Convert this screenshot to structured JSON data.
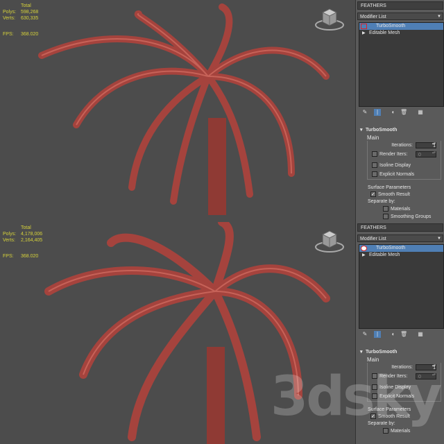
{
  "colors": {
    "feather": "#b5423b",
    "feather_light": "#cf6a5f",
    "viewport_bg": "#4c4c4c",
    "stats": "#d6d23a",
    "selected": "#4f7fb5",
    "highlight_box": "#dd2222"
  },
  "panes": [
    {
      "stats": {
        "total_label": "Total",
        "polys_label": "Polys:",
        "polys": "598,268",
        "verts_label": "Verts:",
        "verts": "630,335",
        "fps_label": "FPS:",
        "fps": "368.020"
      },
      "panel": {
        "object_name": "FEATHERS",
        "modifier_list": "Modifier List",
        "stack": [
          "TurboSmooth",
          "Editable Mesh"
        ],
        "turbosmooth": {
          "title": "TurboSmooth",
          "main_label": "Main",
          "iterations_label": "Iterations:",
          "iterations": "1",
          "render_iters_label": "Render Iters:",
          "render_iters": "0",
          "isoline_label": "Isoline Display",
          "explicit_label": "Explicit Normals",
          "surface_label": "Surface Parameters",
          "smooth_label": "Smooth Result",
          "separate_label": "Separate by:",
          "materials_label": "Materials",
          "smoothing_label": "Smoothing Groups"
        }
      }
    },
    {
      "stats": {
        "total_label": "Total",
        "polys_label": "Polys:",
        "polys": "4,178,006",
        "verts_label": "Verts:",
        "verts": "2,164,405",
        "fps_label": "FPS:",
        "fps": "368.020"
      },
      "panel": {
        "object_name": "FEATHERS",
        "modifier_list": "Modifier List",
        "stack": [
          "TurboSmooth",
          "Editable Mesh"
        ],
        "turbosmooth": {
          "title": "TurboSmooth",
          "main_label": "Main",
          "iterations_label": "Iterations:",
          "iterations": "1",
          "render_iters_label": "Render Iters:",
          "render_iters": "0",
          "isoline_label": "Isoline Display",
          "explicit_label": "Explicit Normals",
          "surface_label": "Surface Parameters",
          "smooth_label": "Smooth Result",
          "separate_label": "Separate by:",
          "materials_label": "Materials"
        }
      }
    }
  ],
  "watermark": "3dsky"
}
